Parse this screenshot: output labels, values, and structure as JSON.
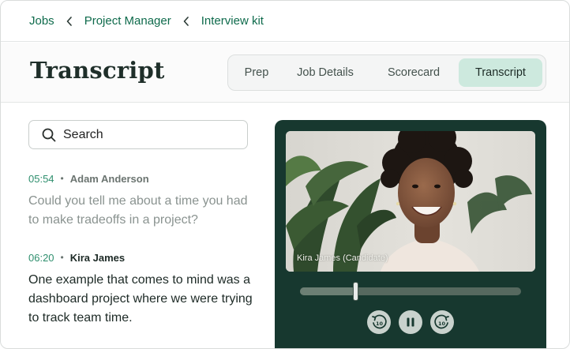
{
  "breadcrumb": {
    "items": [
      "Jobs",
      "Project Manager",
      "Interview kit"
    ]
  },
  "page": {
    "title": "Transcript"
  },
  "tabs": [
    {
      "label": "Prep",
      "active": false
    },
    {
      "label": "Job Details",
      "active": false
    },
    {
      "label": "Scorecard",
      "active": false
    },
    {
      "label": "Transcript",
      "active": true
    }
  ],
  "search": {
    "placeholder": "Search"
  },
  "transcript": [
    {
      "time": "05:54",
      "speaker": "Adam Anderson",
      "text": "Could you tell me about a time you had to make tradeoffs in a project?"
    },
    {
      "time": "06:20",
      "speaker": "Kira James",
      "text": "One example that comes to mind was a dashboard project where we were trying to track team time."
    }
  ],
  "video": {
    "caption": "Kira James (Candidate)",
    "progress_fraction": 0.25,
    "controls": [
      "rewind-10-icon",
      "pause-icon",
      "forward-10-icon"
    ]
  },
  "colors": {
    "accent": "#0f6b4c",
    "active_tab": "#cde9de",
    "player_bg": "#17382f"
  }
}
